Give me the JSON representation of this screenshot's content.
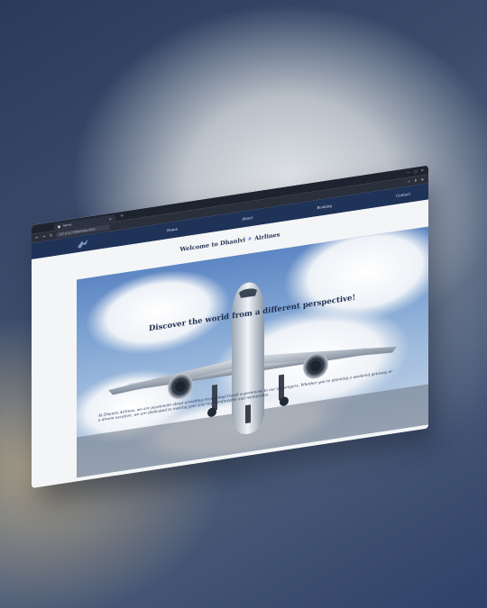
{
  "browser": {
    "tab_title": "Home",
    "url": "127.0.0.1:5500/index.html",
    "controls": [
      "—",
      "▢",
      "✕"
    ],
    "nav_buttons": [
      "←",
      "→",
      "↻"
    ],
    "toolbar_icons": [
      "☆",
      "⬇",
      "≡"
    ]
  },
  "site": {
    "nav_links": [
      "Home",
      "About",
      "Booking",
      "Contact"
    ],
    "welcome_prefix": "Welcome to Dhanlvi",
    "welcome_flag": "✈",
    "welcome_suffix": "Airlines",
    "hero_heading": "Discover the world from a different perspective!",
    "hero_text": "At Dhanlvi Airlines, we are passionate about providing exceptional travel experiences to our passengers. Whether you're planning a weekend getaway or a dream vacation, we are dedicated to making your journey comfortable and memorable."
  },
  "colors": {
    "nav_bg": "#1f3257",
    "heading": "#1f2f52",
    "sky": "#7ea3d3"
  }
}
